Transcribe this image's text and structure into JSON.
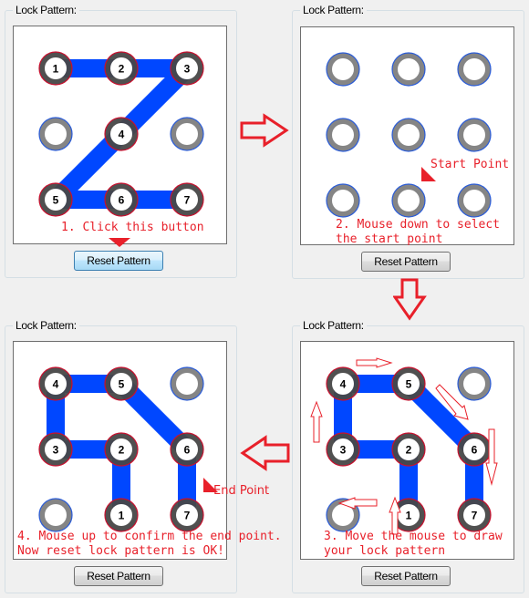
{
  "colors": {
    "path_line": "#0047ff",
    "selected_ring": "#474747",
    "selected_outline": "#c8102e",
    "idle_ring": "#858585",
    "idle_outline": "#2a5cd8",
    "annotation": "#e8202a"
  },
  "panels": [
    {
      "id": "panel-step1",
      "group_title": "Lock Pattern:",
      "reset_button_label": "Reset Pattern",
      "reset_button_focused": true,
      "selected_nodes": [
        {
          "cell": [
            0,
            0
          ],
          "label": "1"
        },
        {
          "cell": [
            1,
            0
          ],
          "label": "2"
        },
        {
          "cell": [
            2,
            0
          ],
          "label": "3"
        },
        {
          "cell": [
            1,
            1
          ],
          "label": "4"
        },
        {
          "cell": [
            0,
            2
          ],
          "label": "5"
        },
        {
          "cell": [
            1,
            2
          ],
          "label": "6"
        },
        {
          "cell": [
            2,
            2
          ],
          "label": "7"
        }
      ],
      "path_order": [
        "1",
        "2",
        "3",
        "4",
        "5",
        "6",
        "7"
      ],
      "annotations": [
        "1. Click this button"
      ]
    },
    {
      "id": "panel-step2",
      "group_title": "Lock Pattern:",
      "reset_button_label": "Reset Pattern",
      "reset_button_focused": false,
      "selected_nodes": [],
      "path_order": [],
      "annotations": [
        "Start Point",
        "2. Mouse down to select",
        "the start point"
      ]
    },
    {
      "id": "panel-step4",
      "group_title": "Lock Pattern:",
      "reset_button_label": "Reset Pattern",
      "reset_button_focused": false,
      "selected_nodes": [
        {
          "cell": [
            1,
            2
          ],
          "label": "1"
        },
        {
          "cell": [
            1,
            1
          ],
          "label": "2"
        },
        {
          "cell": [
            0,
            1
          ],
          "label": "3"
        },
        {
          "cell": [
            0,
            0
          ],
          "label": "4"
        },
        {
          "cell": [
            1,
            0
          ],
          "label": "5"
        },
        {
          "cell": [
            2,
            1
          ],
          "label": "6"
        },
        {
          "cell": [
            2,
            2
          ],
          "label": "7"
        }
      ],
      "path_order": [
        "1",
        "2",
        "3",
        "4",
        "5",
        "6",
        "7"
      ],
      "annotations": [
        "End Point",
        "4. Mouse up to confirm the end point.",
        "Now reset lock pattern is OK!"
      ]
    },
    {
      "id": "panel-step3",
      "group_title": "Lock Pattern:",
      "reset_button_label": "Reset Pattern",
      "reset_button_focused": false,
      "selected_nodes": [
        {
          "cell": [
            1,
            2
          ],
          "label": "1"
        },
        {
          "cell": [
            1,
            1
          ],
          "label": "2"
        },
        {
          "cell": [
            0,
            1
          ],
          "label": "3"
        },
        {
          "cell": [
            0,
            0
          ],
          "label": "4"
        },
        {
          "cell": [
            1,
            0
          ],
          "label": "5"
        },
        {
          "cell": [
            2,
            1
          ],
          "label": "6"
        },
        {
          "cell": [
            2,
            2
          ],
          "label": "7"
        }
      ],
      "path_order": [
        "1",
        "2",
        "3",
        "4",
        "5",
        "6",
        "7"
      ],
      "annotations": [
        "3. Move the mouse to draw",
        "your lock pattern"
      ]
    }
  ],
  "flow_arrows": [
    {
      "direction": "right",
      "from": "step1",
      "to": "step2"
    },
    {
      "direction": "down",
      "from": "step2",
      "to": "step3"
    },
    {
      "direction": "left",
      "from": "step3",
      "to": "step4"
    }
  ]
}
